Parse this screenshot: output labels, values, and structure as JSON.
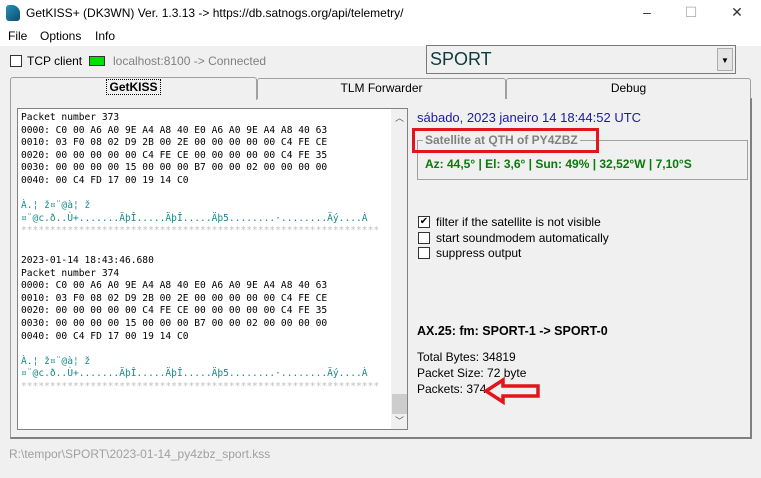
{
  "window": {
    "title": "GetKISS+ (DK3WN) Ver. 1.3.13 -> https://db.satnogs.org/api/telemetry/",
    "minimize": "–",
    "maximize": "☐",
    "close": "✕"
  },
  "menu": [
    "File",
    "Options",
    "Info"
  ],
  "toolbar": {
    "tcp_label": "TCP client",
    "tcp_checked": false,
    "connection": "localhost:8100 -> Connected",
    "connection_color": "#00e000",
    "satellite": "SPORT"
  },
  "tabs": [
    "GetKISS",
    "TLM Forwarder",
    "Debug"
  ],
  "log": {
    "lines": [
      {
        "t": "Packet number 373",
        "c": "hx"
      },
      {
        "t": "0000: C0 00 A6 A0 9E A4 A8 40 E0 A6 A0 9E A4 A8 40 63",
        "c": "hx"
      },
      {
        "t": "0010: 03 F0 08 02 D9 2B 00 2E 00 00 00 00 00 C4 FE CE",
        "c": "hx"
      },
      {
        "t": "0020: 00 00 00 00 00 C4 FE CE 00 00 00 00 00 C4 FE 35",
        "c": "hx"
      },
      {
        "t": "0030: 00 00 00 00 15 00 00 00 B7 00 00 02 00 00 00 00",
        "c": "hx"
      },
      {
        "t": "0040: 00 C4 FD 17 00 19 14 C0",
        "c": "hx"
      },
      {
        "t": "",
        "c": "hx"
      },
      {
        "t": "À.¦ ž¤¨@à¦ ž",
        "c": "as"
      },
      {
        "t": "¤¨@c.ð..Ù+.......ÄþÎ.....ÄþÎ.....Äþ5........·........Äý....À",
        "c": "as"
      },
      {
        "t": "**************************************************************",
        "c": "st"
      },
      {
        "t": "",
        "c": "hx"
      },
      {
        "t": "2023-01-14 18:43:46.680",
        "c": "hx"
      },
      {
        "t": "Packet number 374",
        "c": "hx"
      },
      {
        "t": "0000: C0 00 A6 A0 9E A4 A8 40 E0 A6 A0 9E A4 A8 40 63",
        "c": "hx"
      },
      {
        "t": "0010: 03 F0 08 02 D9 2B 00 2E 00 00 00 00 00 C4 FE CE",
        "c": "hx"
      },
      {
        "t": "0020: 00 00 00 00 00 C4 FE CE 00 00 00 00 00 C4 FE 35",
        "c": "hx"
      },
      {
        "t": "0030: 00 00 00 00 15 00 00 00 B7 00 00 02 00 00 00 00",
        "c": "hx"
      },
      {
        "t": "0040: 00 C4 FD 17 00 19 14 C0",
        "c": "hx"
      },
      {
        "t": "",
        "c": "hx"
      },
      {
        "t": "À.¦ ž¤¨@à¦ ž",
        "c": "as"
      },
      {
        "t": "¤¨@c.ð..Ù+.......ÄþÎ.....ÄþÎ.....Äþ5........·........Äý....À",
        "c": "as"
      },
      {
        "t": "**************************************************************",
        "c": "st"
      }
    ]
  },
  "right": {
    "datetime": "sábado, 2023 janeiro 14  18:44:52 UTC",
    "group_title": "Satellite at QTH of PY4ZBZ",
    "position": "Az: 44,5° | El: 3,6° | Sun: 49% | 32,52°W | 7,10°S",
    "options": [
      {
        "label": "filter if the satellite is not visible",
        "checked": true
      },
      {
        "label": "start soundmodem automatically",
        "checked": false
      },
      {
        "label": "suppress output",
        "checked": false
      }
    ],
    "ax25": "AX.25: fm: SPORT-1 -> SPORT-0",
    "total_bytes": "Total Bytes: 34819",
    "packet_size": "Packet Size: 72 byte",
    "packets": "Packets: 374"
  },
  "status": {
    "path": "R:\\tempor\\SPORT\\2023-01-14_py4zbz_sport.kss"
  },
  "colors": {
    "annotation": "#e3141c",
    "datetime": "#1a1aa6",
    "position": "#0a7a0a"
  }
}
